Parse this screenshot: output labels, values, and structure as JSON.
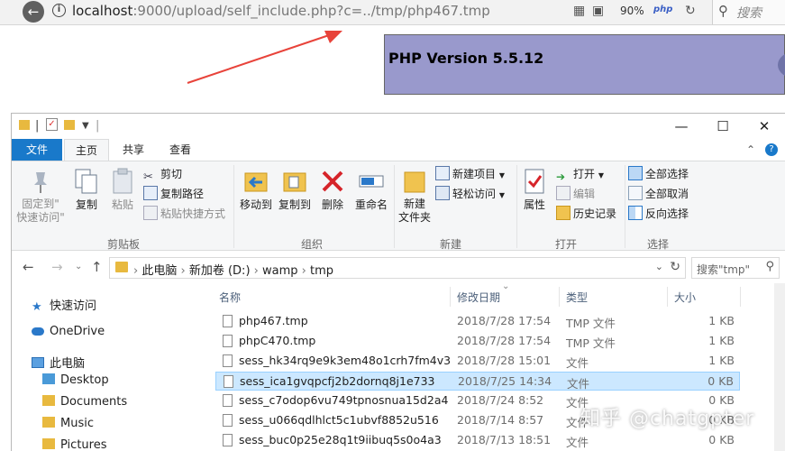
{
  "browser": {
    "url_host": "localhost",
    "url_rest": ":9000/upload/self_include.php?c=../tmp/php467.tmp",
    "zoom": "90%",
    "php_icon": "php",
    "search_placeholder": "搜索"
  },
  "web": {
    "php_title": "PHP Version 5.5.12"
  },
  "explorer": {
    "tabs": {
      "file": "文件",
      "home": "主页",
      "share": "共享",
      "view": "查看"
    },
    "ribbon": {
      "clipboard": {
        "pin": "固定到\"\n快速访问\"",
        "copy": "复制",
        "paste": "粘贴",
        "cut": "剪切",
        "copy_path": "复制路径",
        "paste_shortcut": "粘贴快捷方式",
        "label": "剪贴板"
      },
      "organize": {
        "move_to": "移动到",
        "copy_to": "复制到",
        "delete": "删除",
        "rename": "重命名",
        "label": "组织"
      },
      "new": {
        "new_folder": "新建\n文件夹",
        "new_item": "新建项目",
        "easy_access": "轻松访问",
        "label": "新建"
      },
      "open": {
        "properties": "属性",
        "open": "打开",
        "edit": "编辑",
        "history": "历史记录",
        "label": "打开"
      },
      "select": {
        "select_all": "全部选择",
        "select_none": "全部取消",
        "invert": "反向选择",
        "label": "选择"
      }
    },
    "address": {
      "crumbs": [
        "此电脑",
        "新加卷 (D:)",
        "wamp",
        "tmp"
      ],
      "search_placeholder": "搜索\"tmp\""
    },
    "nav": {
      "quick_access": "快速访问",
      "onedrive": "OneDrive",
      "this_pc": "此电脑",
      "desktop": "Desktop",
      "documents": "Documents",
      "music": "Music",
      "pictures": "Pictures"
    },
    "columns": {
      "name": "名称",
      "date": "修改日期",
      "type": "类型",
      "size": "大小"
    },
    "files": [
      {
        "name": "php467.tmp",
        "date": "2018/7/28 17:54",
        "type": "TMP 文件",
        "size": "1 KB"
      },
      {
        "name": "phpC470.tmp",
        "date": "2018/7/28 17:54",
        "type": "TMP 文件",
        "size": "1 KB"
      },
      {
        "name": "sess_hk34rq9e9k3em48o1crh7fm4v3",
        "date": "2018/7/28 15:01",
        "type": "文件",
        "size": "1 KB"
      },
      {
        "name": "sess_ica1gvqpcfj2b2dornq8j1e733",
        "date": "2018/7/25 14:34",
        "type": "文件",
        "size": "0 KB"
      },
      {
        "name": "sess_c7odop6vu749tpnosnua15d2a4",
        "date": "2018/7/24 8:52",
        "type": "文件",
        "size": "0 KB"
      },
      {
        "name": "sess_u066qdlhlct5c1ubvf8852u516",
        "date": "2018/7/14 8:57",
        "type": "文件",
        "size": "0 KB"
      },
      {
        "name": "sess_buc0p25e28q1t9iibuq5s0o4a3",
        "date": "2018/7/13 18:51",
        "type": "文件",
        "size": "0 KB"
      }
    ],
    "selected_index": 3
  },
  "watermark": "知乎 @chatgpter",
  "colors": {
    "accent": "#1979ca",
    "php_banner": "#9999cc",
    "selection": "#cce8ff",
    "arrow": "#e8433a"
  }
}
